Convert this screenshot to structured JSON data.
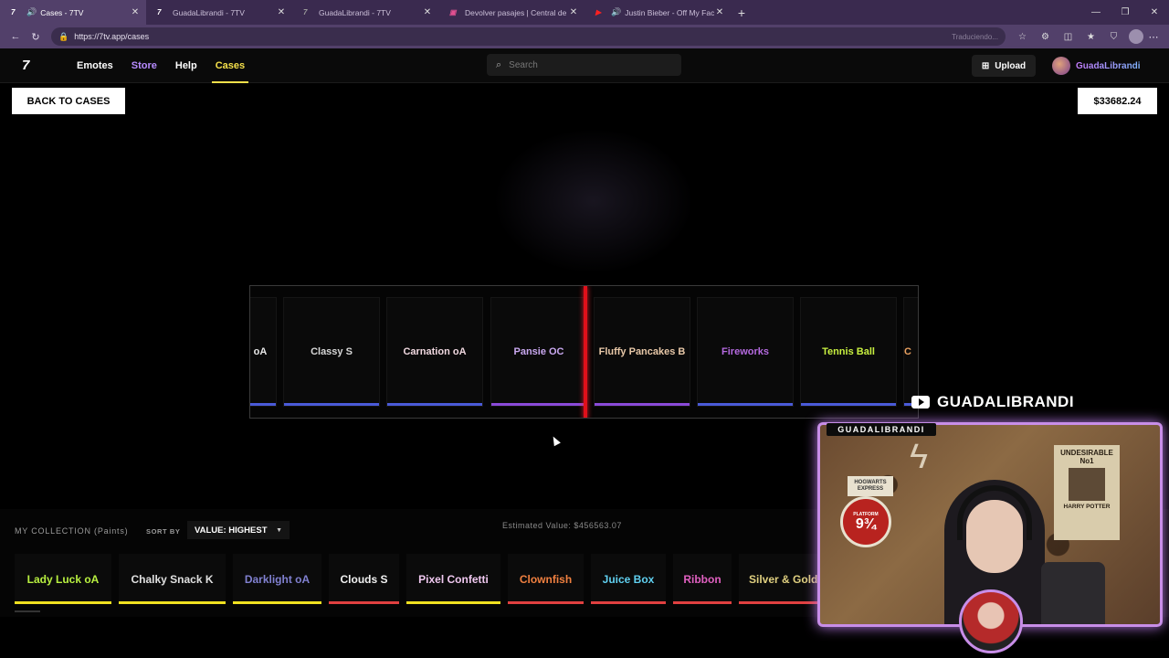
{
  "browser": {
    "tabs": [
      {
        "label": "Cases - 7TV",
        "icon": "7tv-icon",
        "active": true,
        "audio": true
      },
      {
        "label": "GuadaLibrandi - 7TV",
        "icon": "7tv-icon",
        "active": false,
        "audio": false
      },
      {
        "label": "GuadaLibrandi - 7TV",
        "icon": "7tv-icon",
        "active": false,
        "audio": false
      },
      {
        "label": "Devolver pasajes | Central de Pasa",
        "icon": "bus-icon",
        "active": false,
        "audio": false
      },
      {
        "label": "Justin Bieber - Off My Face (V",
        "icon": "youtube-icon",
        "active": false,
        "audio": true
      }
    ],
    "url": "https://7tv.app/cases",
    "translate_hint": "Traduciendo..."
  },
  "nav": {
    "logo": "7",
    "links": [
      "Emotes",
      "Store",
      "Help",
      "Cases"
    ],
    "search_placeholder": "Search",
    "upload_label": "Upload",
    "username": "GuadaLibrandi"
  },
  "page": {
    "back_label": "BACK TO CASES",
    "balance": "$33682.24"
  },
  "spinner": {
    "items": [
      {
        "label": "oA",
        "color": "#e8e8e8",
        "bar": "#4a5ad8"
      },
      {
        "label": "Classy S",
        "color": "#d8d8d8",
        "bar": "#4a5ad8"
      },
      {
        "label": "Carnation oA",
        "color": "#f0d8e0",
        "bar": "#4a5ad8"
      },
      {
        "label": "Pansie OC",
        "color": "#c9a8f0",
        "bar": "#8a4ad8"
      },
      {
        "label": "Fluffy Pancakes B",
        "color": "#e8c8a8",
        "bar": "#8a4ad8"
      },
      {
        "label": "Fireworks",
        "color": "#b56ae0",
        "bar": "#4a5ad8"
      },
      {
        "label": "Tennis Ball",
        "color": "#c8f040",
        "bar": "#4a5ad8"
      },
      {
        "label": "C",
        "color": "#e8a060",
        "bar": "#4a5ad8"
      }
    ]
  },
  "overlay": {
    "youtube_handle": "GUADALIBRANDI",
    "cam_label": "GUADALIBRANDI",
    "hogwarts_sign": "HOGWARTS EXPRESS",
    "platform_text": "PLATFORM",
    "platform_number": "9¾",
    "poster_title": "UNDESIRABLE",
    "poster_no": "No1",
    "poster_name": "HARRY POTTER"
  },
  "collection": {
    "title": "MY COLLECTION (Paints)",
    "sort_label": "SORT BY",
    "sort_value": "VALUE: HIGHEST",
    "estimate": "Estimated Value: $456563.07",
    "items": [
      {
        "label": "Lady Luck oA",
        "color": "#b8f040",
        "bar": "#f0e020"
      },
      {
        "label": "Chalky Snack K",
        "color": "#e0e0e0",
        "bar": "#f0e020"
      },
      {
        "label": "Darklight oA",
        "color": "#8080d0",
        "bar": "#f0e020"
      },
      {
        "label": "Clouds S",
        "color": "#f0f0f0",
        "bar": "#e04040"
      },
      {
        "label": "Pixel Confetti",
        "color": "#f0c8f0",
        "bar": "#f0e020"
      },
      {
        "label": "Clownfish",
        "color": "#f08040",
        "bar": "#e04040"
      },
      {
        "label": "Juice Box",
        "color": "#60d0f0",
        "bar": "#e04040"
      },
      {
        "label": "Ribbon",
        "color": "#e060c0",
        "bar": "#e04040"
      },
      {
        "label": "Silver & Gold",
        "color": "#e0d080",
        "bar": "#e04040"
      }
    ]
  }
}
